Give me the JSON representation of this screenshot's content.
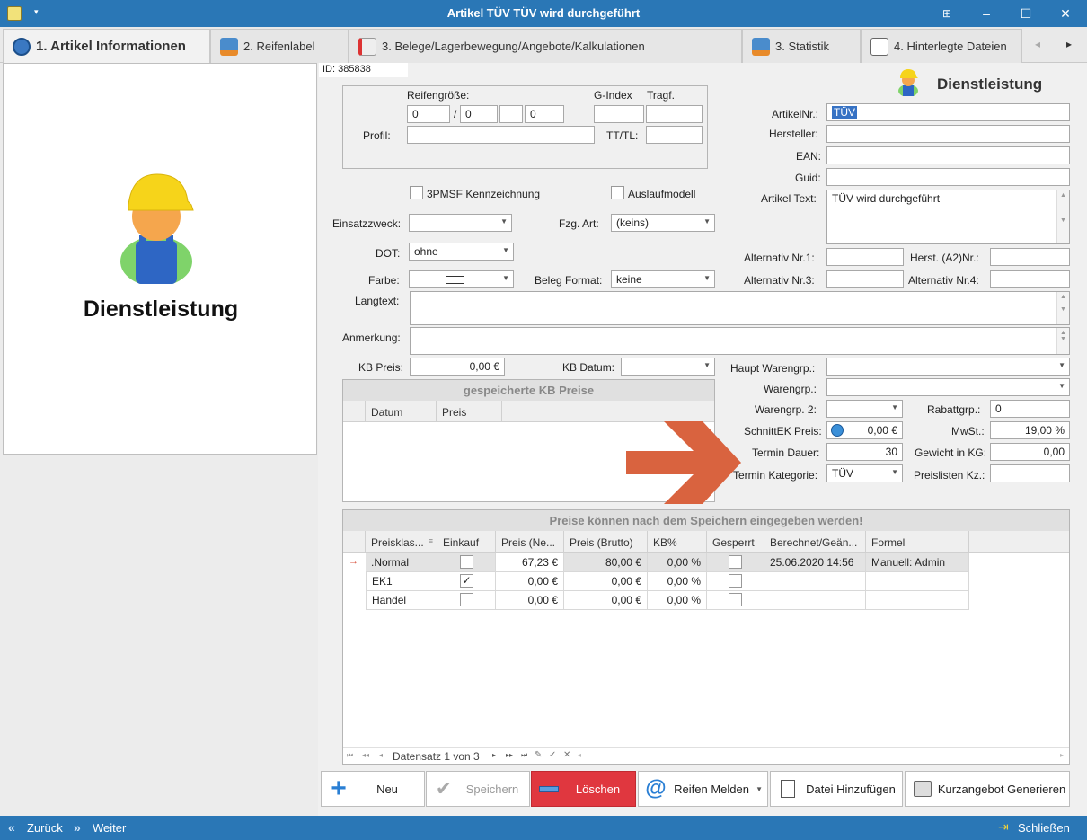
{
  "window": {
    "title": "Artikel TÜV TÜV wird durchgeführt",
    "min": "–",
    "max": "☐",
    "close": "✕",
    "restore": "⊞"
  },
  "tabs": [
    {
      "label": "1. Artikel Informationen"
    },
    {
      "label": "2. Reifenlabel"
    },
    {
      "label": "3. Belege/Lagerbewegung/Angebote/Kalkulationen"
    },
    {
      "label": "3. Statistik"
    },
    {
      "label": "4. Hinterlegte Dateien"
    }
  ],
  "nav": {
    "prev": "◂",
    "next": "▸"
  },
  "left": {
    "caption": "Dienstleistung"
  },
  "id_label": "ID: 385838",
  "header_type": "Dienstleistung",
  "tire": {
    "size_label": "Reifengröße:",
    "gindex_label": "G-Index",
    "tragf_label": "Tragf.",
    "size": [
      "0",
      "0",
      "",
      "0"
    ],
    "slash": "/",
    "profil_label": "Profil:",
    "ttl_label": "TT/TL:"
  },
  "fields": {
    "artikelnr_label": "ArtikelNr.:",
    "artikelnr": "TÜV",
    "hersteller_label": "Hersteller:",
    "hersteller": "",
    "ean_label": "EAN:",
    "ean": "",
    "guid_label": "Guid:",
    "guid": "",
    "artikeltext_label": "Artikel Text:",
    "artikeltext": "TÜV wird durchgeführt",
    "alt1_label": "Alternativ Nr.1:",
    "herst_label": "Herst. (A2)Nr.:",
    "alt3_label": "Alternativ Nr.3:",
    "alt4_label": "Alternativ Nr.4:",
    "cb_3pmsf": "3PMSF Kennzeichnung",
    "cb_auslauf": "Auslaufmodell",
    "einsatz_label": "Einsatzzweck:",
    "einsatz": "",
    "fzg_label": "Fzg. Art:",
    "fzg": "(keins)",
    "dot_label": "DOT:",
    "dot": "ohne",
    "farbe_label": "Farbe:",
    "belegformat_label": "Beleg Format:",
    "belegformat": "keine",
    "langtext_label": "Langtext:",
    "anmerkung_label": "Anmerkung:",
    "kbpreis_label": "KB Preis:",
    "kbpreis": "0,00 €",
    "kbdatum_label": "KB Datum:",
    "kbdatum": "",
    "hauptwg_label": "Haupt Warengrp.:",
    "wg_label": "Warengrp.:",
    "wg2_label": "Warengrp. 2:",
    "wg2": "",
    "rabatt_label": "Rabattgrp.:",
    "rabatt": "0",
    "schnitt_label": "SchnittEK Preis:",
    "schnitt": "0,00 €",
    "mwst_label": "MwSt.:",
    "mwst": "19,00 %",
    "termin_dauer_label": "Termin Dauer:",
    "termin_dauer": "30",
    "gewicht_label": "Gewicht in KG:",
    "gewicht": "0,00",
    "termin_kat_label": "Termin Kategorie:",
    "termin_kat": "TÜV",
    "preislisten_label": "Preislisten Kz.:",
    "preislisten": ""
  },
  "kb": {
    "header": "gespeicherte KB Preise",
    "cols": [
      "Datum",
      "Preis"
    ]
  },
  "prices": {
    "header": "Preise können nach dem Speichern eingegeben werden!",
    "cols": [
      "Preisklas...",
      "Einkauf",
      "Preis (Ne...",
      "Preis (Brutto)",
      "KB%",
      "Gesperrt",
      "Berechnet/Geän...",
      "Formel"
    ],
    "rows": [
      {
        "name": ".Normal",
        "einkauf": false,
        "netto": "67,23 €",
        "brutto": "80,00 €",
        "kb": "0,00 %",
        "gesperrt": false,
        "berechnet": "25.06.2020 14:56",
        "formel": "Manuell: Admin"
      },
      {
        "name": "EK1",
        "einkauf": true,
        "netto": "0,00 €",
        "brutto": "0,00 €",
        "kb": "0,00 %",
        "gesperrt": false,
        "berechnet": "",
        "formel": ""
      },
      {
        "name": "Handel",
        "einkauf": false,
        "netto": "0,00 €",
        "brutto": "0,00 €",
        "kb": "0,00 %",
        "gesperrt": false,
        "berechnet": "",
        "formel": ""
      }
    ],
    "navigator": "Datensatz 1 von 3"
  },
  "buttons": {
    "neu": "Neu",
    "speichern": "Speichern",
    "loeschen": "Löschen",
    "reifen": "Reifen Melden",
    "datei": "Datei Hinzufügen",
    "kurz": "Kurzangebot Generieren"
  },
  "status": {
    "back": "Zurück",
    "forward": "Weiter",
    "close": "Schließen"
  },
  "colors": {
    "titlebar": "#2a77b6",
    "delete": "#e0373f",
    "arrow": "#d9633f"
  }
}
